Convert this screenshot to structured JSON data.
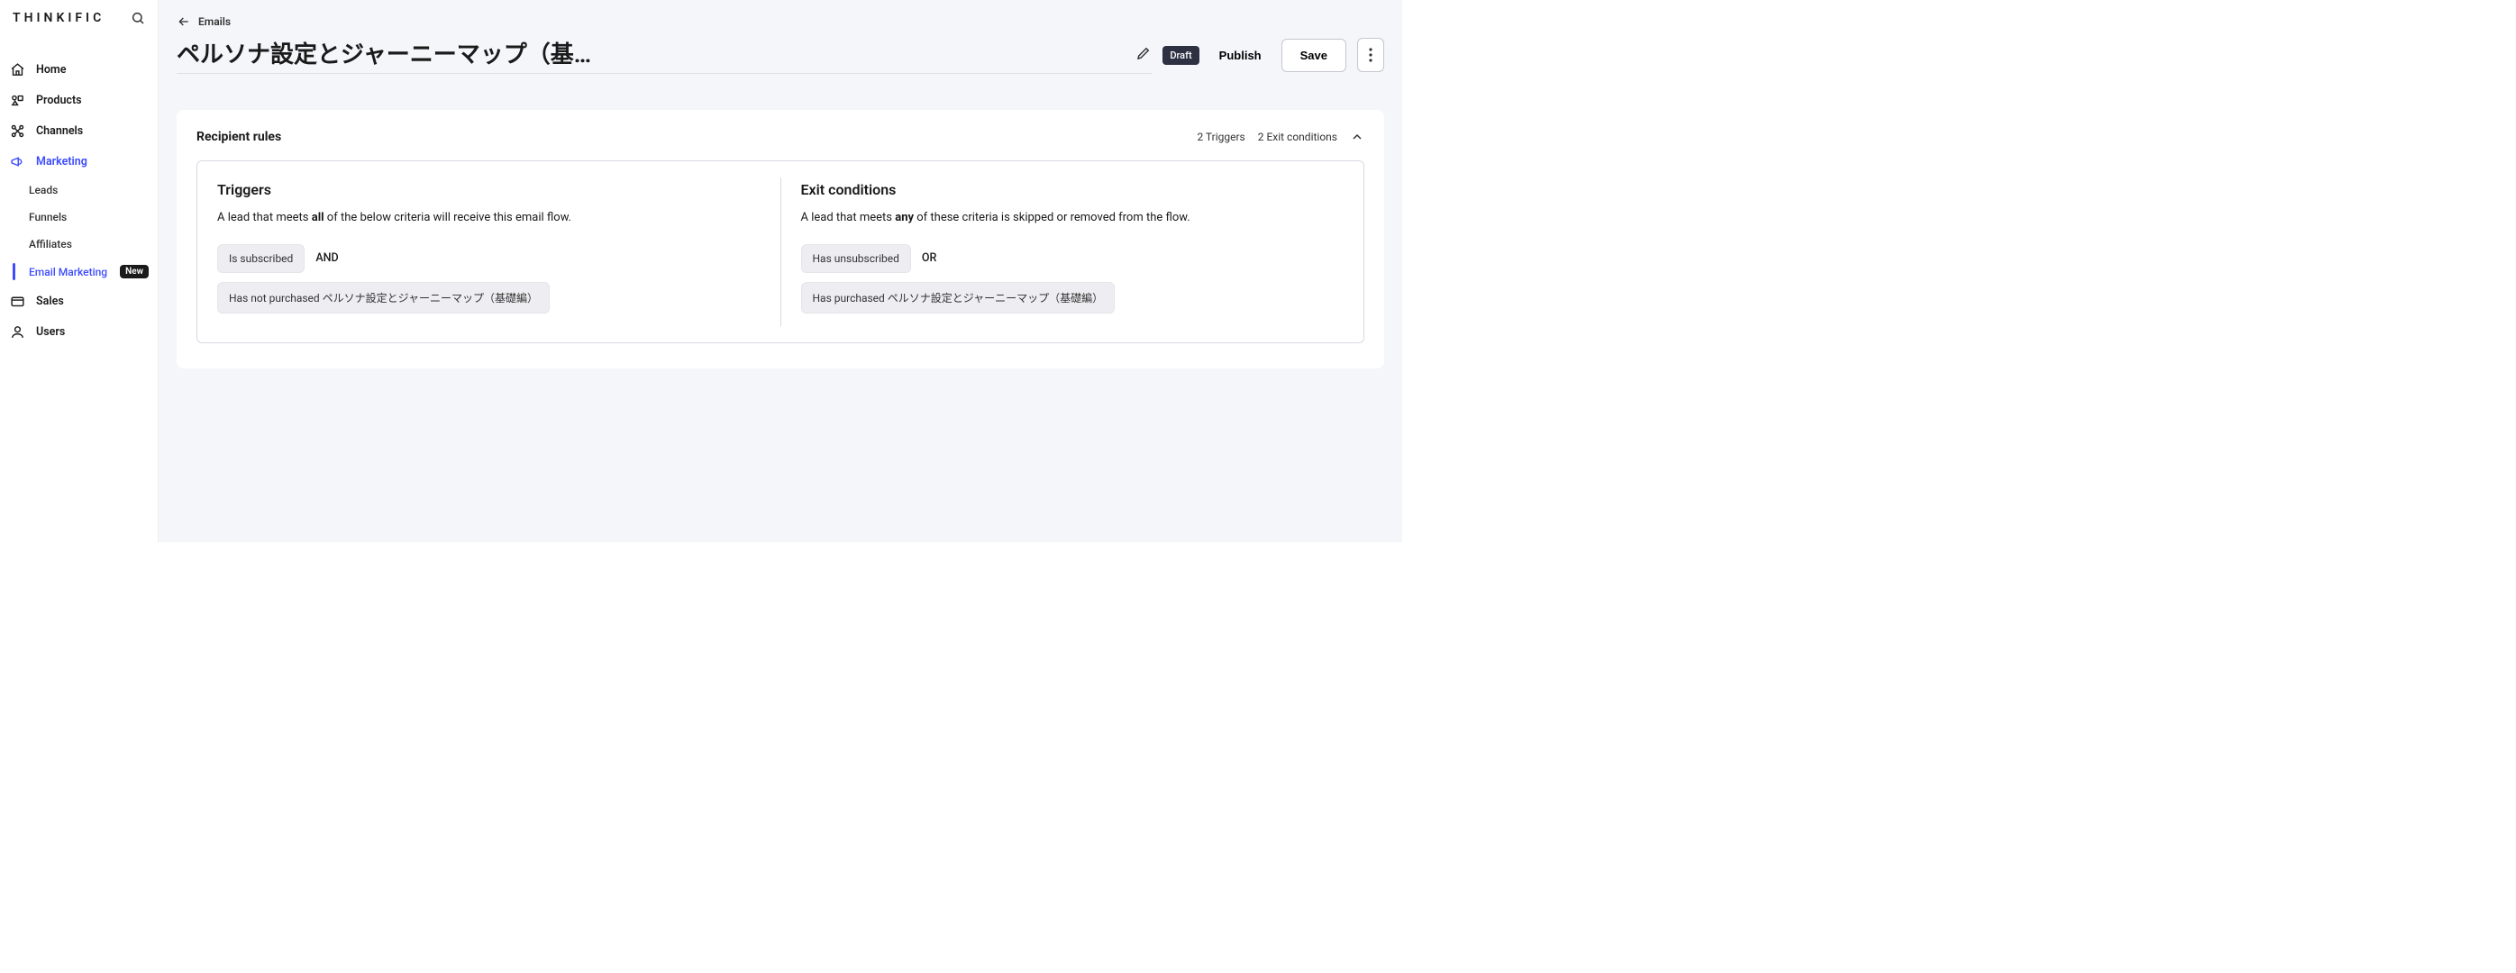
{
  "brand": "THINKIFIC",
  "nav": {
    "home": "Home",
    "products": "Products",
    "channels": "Channels",
    "marketing": "Marketing",
    "sales": "Sales",
    "users": "Users"
  },
  "subnav": {
    "leads": "Leads",
    "funnels": "Funnels",
    "affiliates": "Affiliates",
    "emailMarketing": "Email Marketing",
    "newBadge": "New"
  },
  "breadcrumb": "Emails",
  "title": "ペルソナ設定とジャーニーマップ（基…",
  "statusBadge": "Draft",
  "publish": "Publish",
  "save": "Save",
  "rules": {
    "cardTitle": "Recipient rules",
    "triggersCount": "2 Triggers",
    "exitCount": "2 Exit conditions",
    "triggers": {
      "heading": "Triggers",
      "descPre": "A lead that meets ",
      "descBold": "all",
      "descPost": " of the below criteria will receive this email flow.",
      "chip1": "Is subscribed",
      "connector": "AND",
      "chip2": "Has not purchased ペルソナ設定とジャーニーマップ（基礎編）"
    },
    "exit": {
      "heading": "Exit conditions",
      "descPre": "A lead that meets ",
      "descBold": "any",
      "descPost": " of these criteria is skipped or removed from the flow.",
      "chip1": "Has unsubscribed",
      "connector": "OR",
      "chip2": "Has purchased ペルソナ設定とジャーニーマップ（基礎編）"
    }
  }
}
